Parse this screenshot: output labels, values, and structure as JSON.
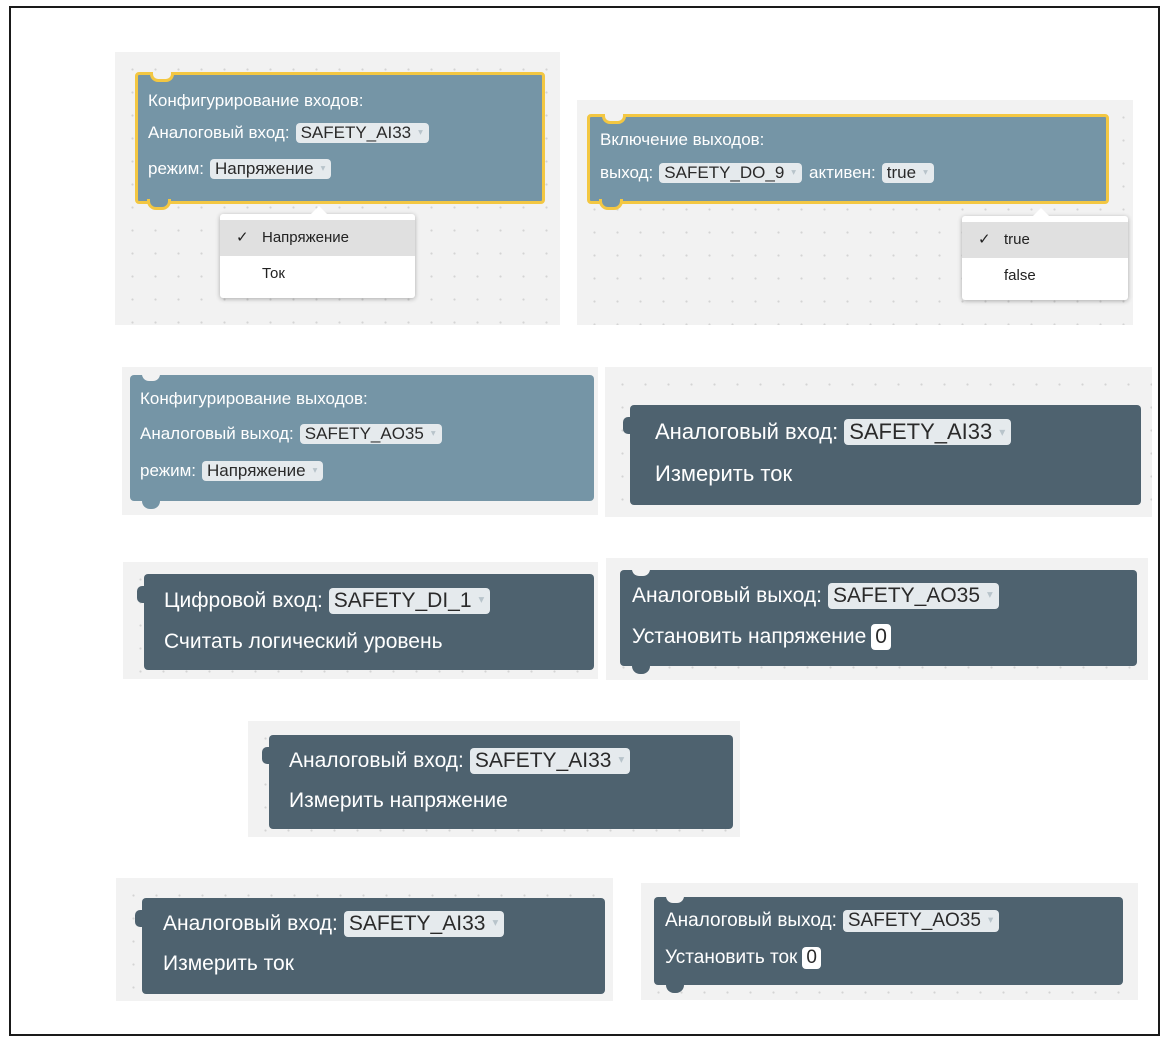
{
  "colors": {
    "block_blue": "#7595a6",
    "block_dark": "#4e626f",
    "selection": "#f3c742",
    "workspace": "#f2f2f2",
    "field": "#e5eaed"
  },
  "icons": {
    "dropdown_arrow": "▾",
    "check": "✓"
  },
  "block_config_inputs": {
    "title": "Конфигурирование входов:",
    "input_label": "Аналоговый вход:",
    "input_value": "SAFETY_AI33",
    "mode_label": "режим:",
    "mode_value": "Напряжение",
    "menu": {
      "options": [
        "Напряжение",
        "Ток"
      ],
      "selected": "Напряжение"
    }
  },
  "block_enable_outputs": {
    "title": "Включение выходов:",
    "output_label": "выход:",
    "output_value": "SAFETY_DO_9",
    "active_label": "активен:",
    "active_value": "true",
    "menu": {
      "options": [
        "true",
        "false"
      ],
      "selected": "true"
    }
  },
  "block_config_outputs": {
    "title": "Конфигурирование выходов:",
    "output_label": "Аналоговый выход:",
    "output_value": "SAFETY_AO35",
    "mode_label": "режим:",
    "mode_value": "Напряжение"
  },
  "block_ai_current_1": {
    "label": "Аналоговый вход:",
    "value": "SAFETY_AI33",
    "action": "Измерить ток"
  },
  "block_di_read": {
    "label": "Цифровой вход:",
    "value": "SAFETY_DI_1",
    "action": "Считать логический уровень"
  },
  "block_ao_voltage": {
    "label": "Аналоговый выход:",
    "value": "SAFETY_AO35",
    "action": "Установить напряжение",
    "number": "0"
  },
  "block_ai_voltage": {
    "label": "Аналоговый вход:",
    "value": "SAFETY_AI33",
    "action": "Измерить напряжение"
  },
  "block_ai_current_2": {
    "label": "Аналоговый вход:",
    "value": "SAFETY_AI33",
    "action": "Измерить ток"
  },
  "block_ao_current": {
    "label": "Аналоговый выход:",
    "value": "SAFETY_AO35",
    "action": "Установить ток",
    "number": "0"
  }
}
